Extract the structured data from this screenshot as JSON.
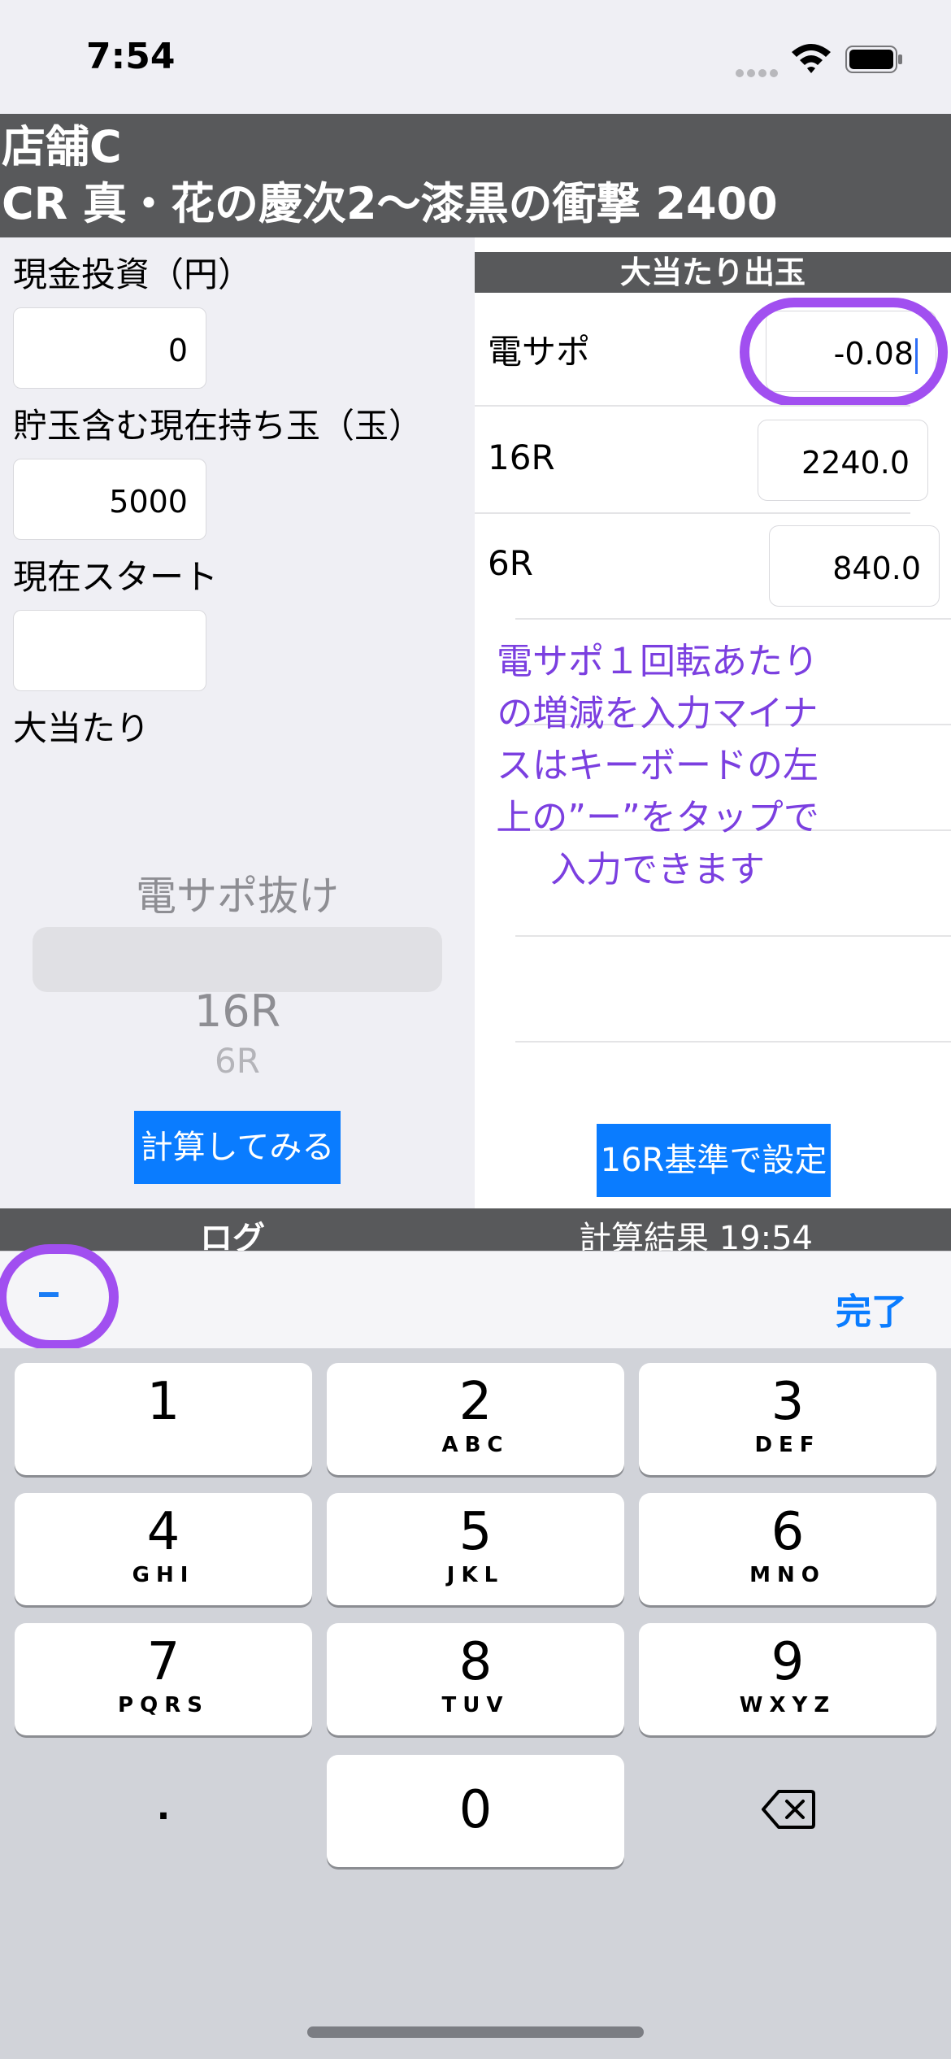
{
  "status": {
    "time": "7:54"
  },
  "header": {
    "store": "店舗C",
    "machine": "CR 真・花の慶次2〜漆黒の衝撃 2400"
  },
  "left": {
    "cash_label": "現金投資（円）",
    "cash_value": "0",
    "balls_label": "貯玉含む現在持ち玉（玉）",
    "balls_value": "5000",
    "start_label": "現在スタート",
    "start_value": "",
    "jackpot_label": "大当たり",
    "picker": [
      "電サポ抜け",
      "16R",
      "6R"
    ],
    "calc_button": "計算してみる"
  },
  "right": {
    "section_title": "大当たり出玉",
    "rows": [
      {
        "label": "電サポ",
        "value": "-0.08"
      },
      {
        "label": "16R",
        "value": "2240.0"
      },
      {
        "label": "6R",
        "value": "840.0"
      }
    ],
    "hint": "電サポ１回転あたりの増減を入力マイナスはキーボードの左上の”ー”をタップで入力できます",
    "standard_button": "16R基準で設定"
  },
  "tabs": {
    "log": "ログ",
    "result": "計算結果 19:54"
  },
  "toolbar": {
    "minus": "-",
    "done": "完了"
  },
  "keyboard": {
    "keys": [
      {
        "num": "1",
        "letters": ""
      },
      {
        "num": "2",
        "letters": "ABC"
      },
      {
        "num": "3",
        "letters": "DEF"
      },
      {
        "num": "4",
        "letters": "GHI"
      },
      {
        "num": "5",
        "letters": "JKL"
      },
      {
        "num": "6",
        "letters": "MNO"
      },
      {
        "num": "7",
        "letters": "PQRS"
      },
      {
        "num": "8",
        "letters": "TUV"
      },
      {
        "num": "9",
        "letters": "WXYZ"
      }
    ],
    "dot": ".",
    "zero": "0"
  },
  "colors": {
    "accent": "#0a7cff",
    "annotation": "#a14ff0",
    "header": "#58595b"
  }
}
